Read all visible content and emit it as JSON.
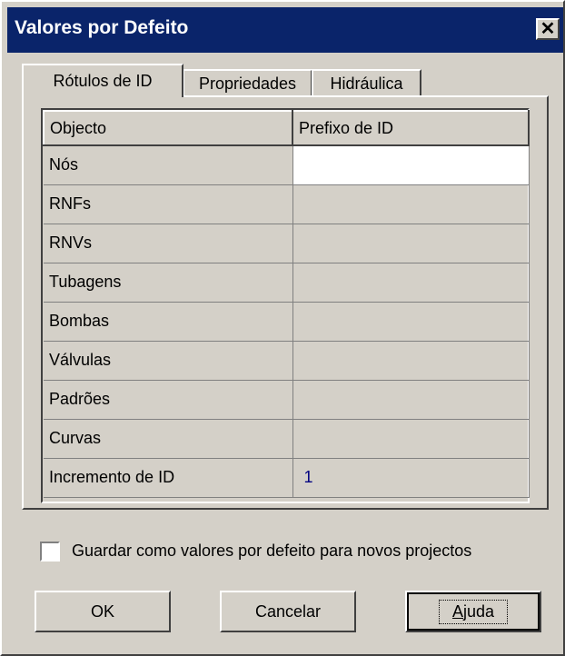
{
  "window": {
    "title": "Valores por Defeito",
    "close_icon": "close-icon"
  },
  "tabs": [
    {
      "label": "Rótulos de ID",
      "active": true
    },
    {
      "label": "Propriedades",
      "active": false
    },
    {
      "label": "Hidráulica",
      "active": false
    }
  ],
  "grid": {
    "headers": [
      "Objecto",
      "Prefixo de ID"
    ],
    "rows": [
      {
        "object": "Nós",
        "prefix": ""
      },
      {
        "object": "RNFs",
        "prefix": ""
      },
      {
        "object": "RNVs",
        "prefix": ""
      },
      {
        "object": "Tubagens",
        "prefix": ""
      },
      {
        "object": "Bombas",
        "prefix": ""
      },
      {
        "object": "Válvulas",
        "prefix": ""
      },
      {
        "object": "Padrões",
        "prefix": ""
      },
      {
        "object": "Curvas",
        "prefix": ""
      },
      {
        "object": "Incremento de ID",
        "prefix": "1"
      }
    ]
  },
  "options": {
    "save_defaults_label": "Guardar como valores por defeito para novos projectos",
    "save_defaults_checked": false
  },
  "buttons": {
    "ok": "OK",
    "cancel": "Cancelar",
    "help_access_key": "A",
    "help_rest": "juda"
  },
  "colors": {
    "titlebar": "#0a246a",
    "dialog_face": "#d4d0c8",
    "increment_value": "#000080"
  }
}
